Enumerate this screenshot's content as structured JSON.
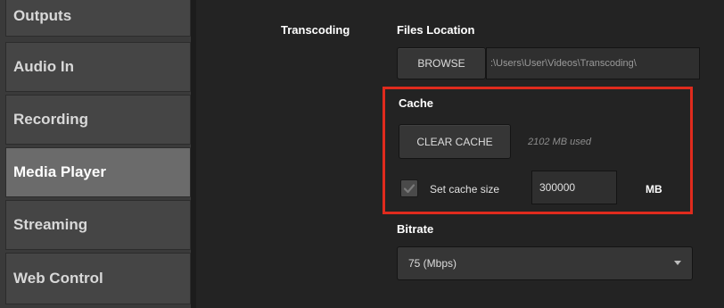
{
  "sidebar": {
    "items": [
      {
        "label": "Outputs"
      },
      {
        "label": "Audio In"
      },
      {
        "label": "Recording"
      },
      {
        "label": "Media Player",
        "active": true
      },
      {
        "label": "Streaming"
      },
      {
        "label": "Web Control"
      }
    ]
  },
  "transcoding": {
    "section_label": "Transcoding",
    "files_location": {
      "label": "Files Location",
      "browse_label": "BROWSE",
      "path_value": ":\\Users\\User\\Videos\\Transcoding\\"
    },
    "cache": {
      "label": "Cache",
      "clear_label": "CLEAR CACHE",
      "used_text": "2102 MB used",
      "set_size_label": "Set cache size",
      "set_size_checked": true,
      "size_value": "300000",
      "size_unit": "MB"
    },
    "bitrate": {
      "label": "Bitrate",
      "selected": "75 (Mbps)"
    }
  },
  "colors": {
    "highlight": "#e02b1d",
    "active_nav": "#6b6b6b"
  }
}
